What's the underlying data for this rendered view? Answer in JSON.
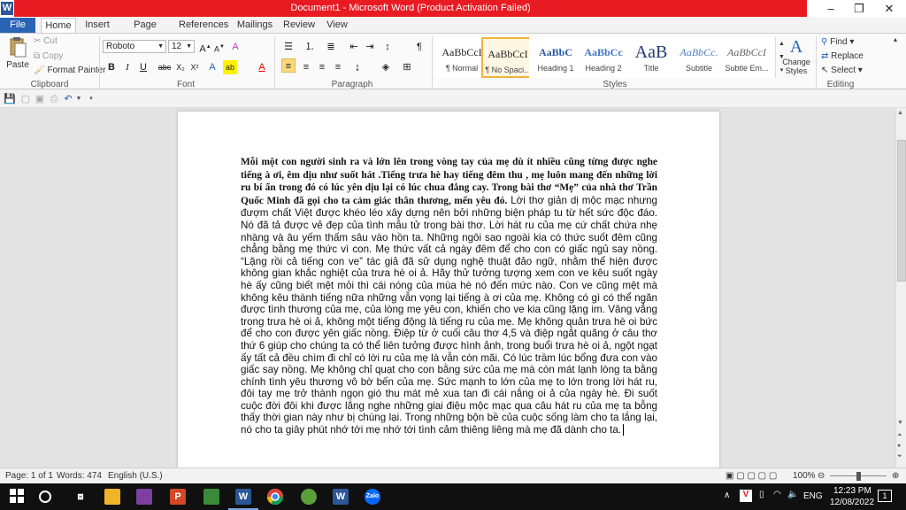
{
  "window": {
    "title": "Document1 - Microsoft Word (Product Activation Failed)",
    "app_icon_letter": "W",
    "minimize": "–",
    "maximize": "❐",
    "close": "✕",
    "accent": "#e81b23"
  },
  "tabs": [
    {
      "label": "File"
    },
    {
      "label": "Home"
    },
    {
      "label": "Insert"
    },
    {
      "label": "Page Layout"
    },
    {
      "label": "References"
    },
    {
      "label": "Mailings"
    },
    {
      "label": "Review"
    },
    {
      "label": "View"
    }
  ],
  "ribbon": {
    "clipboard": {
      "paste": "Paste",
      "cut": "Cut",
      "copy": "Copy",
      "format_painter": "Format Painter",
      "label": "Clipboard"
    },
    "font": {
      "family": "Roboto",
      "size": "12",
      "label": "Font"
    },
    "paragraph": {
      "label": "Paragraph"
    },
    "styles": {
      "label": "Styles",
      "items": [
        {
          "preview": "AaBbCcI",
          "name": "¶ Normal"
        },
        {
          "preview": "AaBbCcI",
          "name": "¶ No Spaci..."
        },
        {
          "preview": "AaBbC",
          "name": "Heading 1"
        },
        {
          "preview": "AaBbCc",
          "name": "Heading 2"
        },
        {
          "preview": "AaB",
          "name": "Title"
        },
        {
          "preview": "AaBbCc.",
          "name": "Subtitle"
        },
        {
          "preview": "AaBbCcI",
          "name": "Subtle Em..."
        }
      ],
      "change_styles": "Change Styles"
    },
    "editing": {
      "find": "Find",
      "replace": "Replace",
      "select": "Select",
      "label": "Editing"
    }
  },
  "document": {
    "serif_part": "Mỗi một con người sinh ra và lớn lên trong vòng tay của mẹ dù ít nhiều cũng từng được nghe tiếng à ơi, êm dịu như suốt hát .Tiếng trưa hè hay tiếng đêm thu , mẹ luôn mang đến những lời ru bí ẩn trong đó có lúc yên dịu lại có lúc chua đắng cay. Trong bài thơ “Mẹ” của nhà thơ Trần Quốc Minh đã gọi cho ta cảm giác thân thương, mến yêu đó.",
    "sans_part": " Lời thơ giản dị mộc mạc nhưng đượm chất Việt được khéo léo xây dựng nên bởi những biện pháp tu từ hết sức độc đáo. Nó đã tả được vẻ đẹp của tình mẫu tử trong bài thơ. Lời hát ru của mẹ cứ chất chứa nhẹ nhàng và âu yếm thấm sâu vào hồn ta. Những ngôi sao ngoài kia có thức suốt đêm cũng chẳng bằng mẹ thức vì con. Mẹ thức vất cả ngày đêm để cho con có giấc ngủ say nồng. “Lặng rồi cả tiếng con ve” tác giả đã sử dụng nghệ thuật đảo ngữ, nhằm thể hiện được không gian khắc nghiệt của trưa hè oi ả. Hãy thử tưởng tượng xem con ve kêu suốt ngày hè ấy cũng biết mệt mỏi thì cái nóng của mùa hè nó đến mức nào. Con ve cũng mệt mà không kêu thành tiếng nữa những vẫn vọng lại tiếng à ơi của mẹ. Không có gì có thể ngăn được tình thương của mẹ, của lòng mẹ yêu con, khiến cho ve kia cũng lặng im. Văng vẳng trong trưa hè oi ả, không một tiếng động là tiếng ru của mẹ. Mẹ không quản trưa hè oi bức để cho con được yên giấc nồng. Điệp từ ở cuối câu thơ 4,5 và điệp ngắt quãng ở câu thơ thứ 6 giúp cho chúng ta có thể liên tưởng được hình ảnh, trong buổi trưa hè oi ả, ngột ngạt ấy tất cả đều chìm đi chỉ có lời ru của mẹ là vẫn còn mãi. Có lúc trầm lúc bổng đưa con vào giấc say nồng. Mẹ không chỉ quạt cho con bằng sức của mẹ mà còn mát lạnh lòng ta bằng chính tình yêu thương vô bờ bến của mẹ. Sức mạnh to lớn của mẹ to lớn trong lời hát ru, đôi tay mẹ trở thành ngọn gió thu mát mẻ xua tan đi cái nắng oi ả của ngày hè. Đi suốt cuộc đời đôi khi được lắng nghe những giai điệu mộc mạc qua câu hát ru của mẹ ta bỗng thấy thời gian này như bị chùng lại. Trong những bộn bề của cuộc sống làm cho ta lắng lại, nó cho ta giây phút nhớ tới mẹ nhớ tới tình cảm thiêng liêng mà mẹ đã dành cho ta."
  },
  "status": {
    "page": "Page: 1 of 1",
    "words": "Words: 474",
    "language": "English (U.S.)",
    "zoom": "100%"
  },
  "taskbar": {
    "lang": "ENG",
    "time": "12:23 PM",
    "date": "12/08/2022",
    "notifications": "1"
  }
}
